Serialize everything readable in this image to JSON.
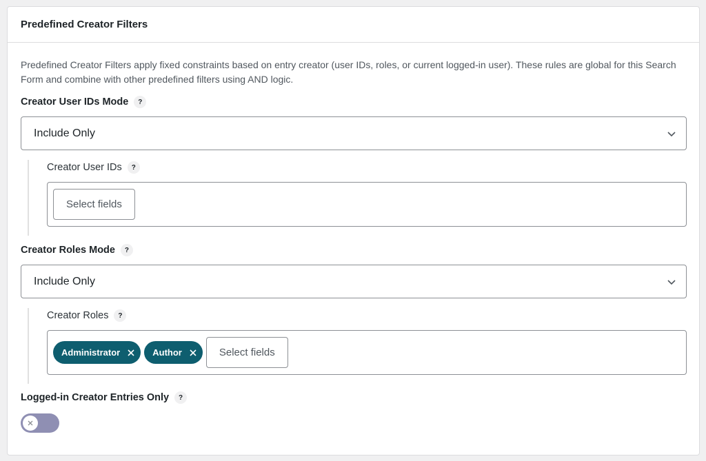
{
  "panel": {
    "title": "Predefined Creator Filters",
    "description": "Predefined Creator Filters apply fixed constraints based on entry creator (user IDs, roles, or current logged-in user). These rules are global for this Search Form and combine with other predefined filters using AND logic."
  },
  "user_ids_mode": {
    "label": "Creator User IDs Mode",
    "help": "?",
    "selected": "Include Only"
  },
  "user_ids": {
    "label": "Creator User IDs",
    "help": "?",
    "button_label": "Select fields"
  },
  "roles_mode": {
    "label": "Creator Roles Mode",
    "help": "?",
    "selected": "Include Only"
  },
  "roles": {
    "label": "Creator Roles",
    "help": "?",
    "chips": [
      "Administrator",
      "Author"
    ],
    "button_label": "Select fields"
  },
  "logged_in_only": {
    "label": "Logged-in Creator Entries Only",
    "help": "?",
    "enabled": false
  },
  "colors": {
    "chip_bg": "#0e5e6f",
    "toggle_off": "#8f8fb3"
  },
  "icons": {
    "select_arrow": "chevron-down-icon",
    "chip_remove": "close-icon",
    "toggle_off": "x-icon"
  }
}
